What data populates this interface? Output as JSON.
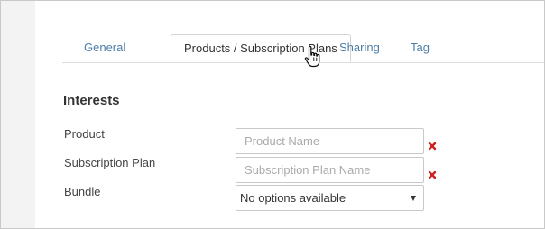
{
  "tabs": [
    {
      "label": "General",
      "active": false
    },
    {
      "label": "Products / Subscription Plans",
      "active": true
    },
    {
      "label": "Sharing",
      "active": false
    },
    {
      "label": "Tag",
      "active": false
    }
  ],
  "section": {
    "title": "Interests"
  },
  "fields": {
    "product": {
      "label": "Product",
      "placeholder": "Product Name",
      "value": ""
    },
    "subscription_plan": {
      "label": "Subscription Plan",
      "placeholder": "Subscription Plan Name",
      "value": ""
    },
    "bundle": {
      "label": "Bundle",
      "selected": "No options available"
    }
  },
  "icons": {
    "remove": "close-icon",
    "cursor": "hand-pointer-icon",
    "dropdown": "chevron-down-icon"
  },
  "colors": {
    "link": "#4d7ea8",
    "remove": "#cc1f1f",
    "text": "#333333"
  }
}
